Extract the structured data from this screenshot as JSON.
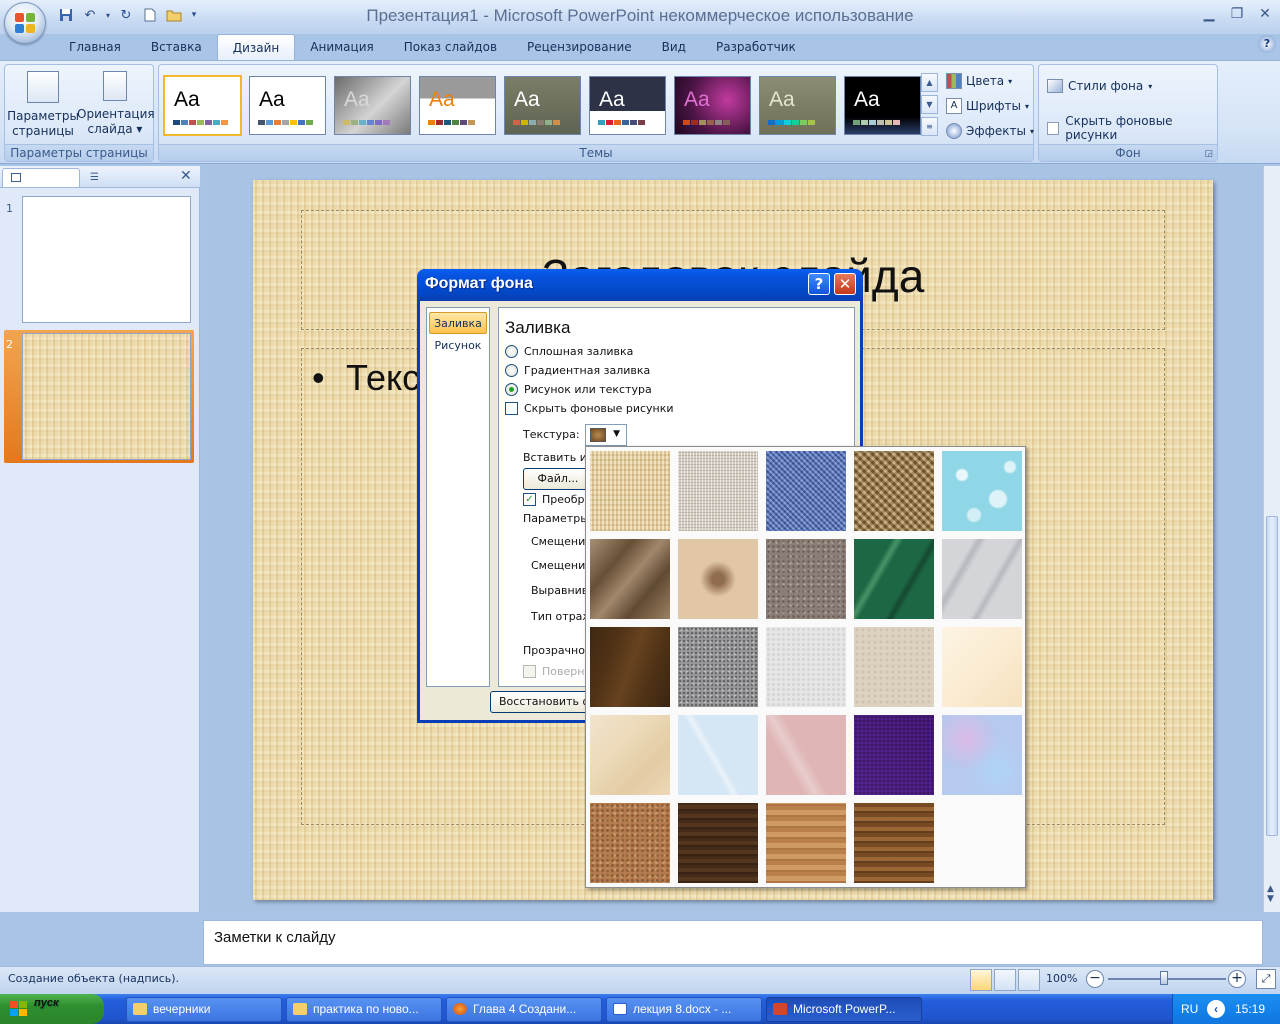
{
  "window": {
    "title": "Презентация1 - Microsoft PowerPoint некоммерческое использование"
  },
  "ribbon_tabs": [
    {
      "label": "Главная",
      "active": false
    },
    {
      "label": "Вставка",
      "active": false
    },
    {
      "label": "Дизайн",
      "active": true
    },
    {
      "label": "Анимация",
      "active": false
    },
    {
      "label": "Показ слайдов",
      "active": false
    },
    {
      "label": "Рецензирование",
      "active": false
    },
    {
      "label": "Вид",
      "active": false
    },
    {
      "label": "Разработчик",
      "active": false
    }
  ],
  "ribbon": {
    "page_setup": {
      "group_label": "Параметры страницы",
      "page_params_line1": "Параметры",
      "page_params_line2": "страницы",
      "orientation_line1": "Ориентация",
      "orientation_line2": "слайда ▾"
    },
    "themes": {
      "group_label": "Темы",
      "sample_text": "Aa",
      "colors": "Цвета",
      "fonts": "Шрифты",
      "effects": "Эффекты"
    },
    "background": {
      "group_label": "Фон",
      "styles": "Стили фона",
      "hide_graphics": "Скрыть фоновые рисунки"
    }
  },
  "slides_pane": {
    "slides": [
      {
        "number": "1"
      },
      {
        "number": "2",
        "selected": true
      }
    ]
  },
  "slide": {
    "title": "Заголовок слайда",
    "body": "Текст слайда"
  },
  "notes": {
    "placeholder": "Заметки к слайду"
  },
  "status_bar": {
    "text": "Создание объекта (надпись).",
    "zoom": "100%"
  },
  "dialog": {
    "title": "Формат фона",
    "help": "?",
    "close": "✕",
    "nav": [
      "Заливка",
      "Рисунок"
    ],
    "section": "Заливка",
    "fill_options": [
      {
        "label": "Сплошная заливка",
        "selected": false
      },
      {
        "label": "Градиентная заливка",
        "selected": false
      },
      {
        "label": "Рисунок или текстура",
        "selected": true
      }
    ],
    "hide_graphics": "Скрыть фоновые рисунки",
    "texture_label": "Текстура:",
    "insert_from": "Вставить из",
    "file_button": "Файл...",
    "transform": "Преобра",
    "params": "Параметры",
    "offset1": "Смещение",
    "offset2": "Смещение",
    "align": "Выравнива",
    "mirror": "Тип отраж",
    "transparency": "Прозрачность",
    "rotate": "Поверну",
    "reset_button": "Восстановить фо"
  },
  "texture_gallery": {
    "textures": [
      {
        "name": "papyrus",
        "color": "#e9d3a0"
      },
      {
        "name": "canvas",
        "color": "#d8cfc0"
      },
      {
        "name": "denim",
        "color": "#5577c2"
      },
      {
        "name": "woven-mat",
        "color": "#a98757"
      },
      {
        "name": "water-droplets",
        "color": "#8fd7e6"
      },
      {
        "name": "paper-bag",
        "color": "#8a6a48"
      },
      {
        "name": "fish-fossil",
        "color": "#e1c7a6"
      },
      {
        "name": "sand",
        "color": "#8b7e76"
      },
      {
        "name": "green-marble",
        "color": "#1d6844"
      },
      {
        "name": "white-marble",
        "color": "#d3d5d8"
      },
      {
        "name": "brown-marble",
        "color": "#523417"
      },
      {
        "name": "granite",
        "color": "#9a9a9c"
      },
      {
        "name": "newsprint",
        "color": "#e6e6e6"
      },
      {
        "name": "recycled-paper",
        "color": "#ddd2c0"
      },
      {
        "name": "parchment",
        "color": "#fbecd2"
      },
      {
        "name": "stationery",
        "color": "#ecd9b8"
      },
      {
        "name": "blue-tissue-paper",
        "color": "#d5e6f4"
      },
      {
        "name": "pink-tissue-paper",
        "color": "#dfb5b5"
      },
      {
        "name": "purple-mesh",
        "color": "#4c1c82"
      },
      {
        "name": "bouquet",
        "color": "#b6c9ee"
      },
      {
        "name": "cork",
        "color": "#b57c4f"
      },
      {
        "name": "walnut",
        "color": "#4b2f1c"
      },
      {
        "name": "oak",
        "color": "#c48a54"
      },
      {
        "name": "medium-wood",
        "color": "#8a5a2c"
      }
    ]
  },
  "taskbar": {
    "start": "пуск",
    "items": [
      {
        "label": "вечерники",
        "active": false
      },
      {
        "label": "практика по ново...",
        "active": false
      },
      {
        "label": "Глава 4 Создани...",
        "active": false
      },
      {
        "label": "лекция 8.docx - ...",
        "active": false
      },
      {
        "label": "Microsoft PowerP...",
        "active": true
      }
    ],
    "lang": "RU",
    "time": "15:19"
  }
}
